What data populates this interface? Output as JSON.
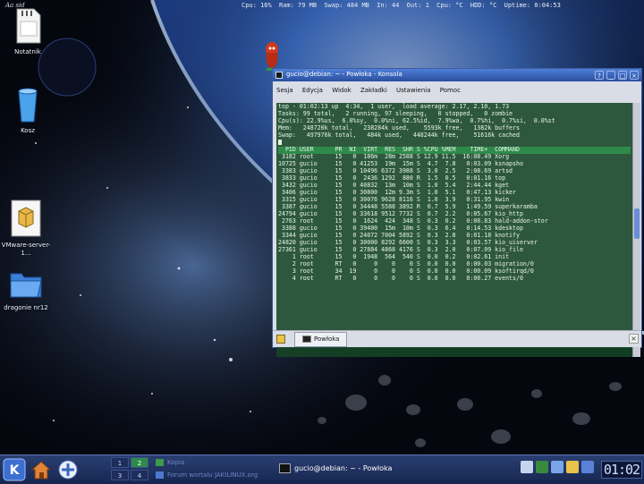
{
  "desktop": {
    "corner_text": "Aa sid",
    "icons": [
      {
        "label": "Notatnik"
      },
      {
        "label": "Kosz"
      },
      {
        "label": "VMware-server-1..."
      },
      {
        "label": "dragonie nr12"
      }
    ]
  },
  "system_monitor": {
    "items": [
      "Cpu: 16%",
      "Ram: 79 MB",
      "Swap: 484 MB",
      "In: 44",
      "Out: 1",
      "Cpu: °C",
      "HDD: °C",
      "Uptime: 0:04:53"
    ]
  },
  "konsole": {
    "title": "gucio@debian: ~ - Powłoka - Konsola",
    "menu": [
      "Sesja",
      "Edycja",
      "Widok",
      "Zakładki",
      "Ustawienia",
      "Pomoc"
    ],
    "tab_label": "Powłoka",
    "summary_lines": [
      "top - 01:02:13 up  4:34,  1 user,  load average: 2.17, 2.10, 1.73",
      "Tasks: 99 total,   2 running, 97 sleeping,   0 stopped,   0 zombie",
      "Cpu(s): 22.9%us,  6.0%sy,  0.0%ni, 62.5%id,  7.9%wa,  0.7%hi,  0.7%si,  0.0%st",
      "Mem:   248720k total,   238284k used,    5593k free,   1382k buffers",
      "Swap:   497976k total,   484k used,   448244k free,    51616k cached"
    ],
    "column_header": "  PID USER      PR  NI  VIRT  RES  SHR S %CPU %MEM    TIME+  COMMAND",
    "processes": [
      " 3182 root      15   0  186m  28m 2588 S 12.9 11.5  16:08.49 Xorg",
      "10725 gucio     15   0 41253  19m  15m S  4.7  7.8   0:03.09 ksnapsho",
      " 3383 gucio     15   0 10496 6372 3988 S  3.0  2.5   2:08.69 artsd",
      " 3833 gucio     15   0  2436 1292  880 R  1.5  0.5   0:01.16 top",
      " 3432 gucio     15   0 40832  13m  10m S  1.0  5.4   2:44.44 kget",
      " 3406 gucio     15   0 30800  12m 9.3m S  1.0  5.1   0:47.13 kicker",
      " 3315 gucio     15   0 30076 9628 8116 S  1.0  3.9   0:31.95 kwin",
      " 3387 gucio     15   0 34448 5588 3892 R  0.7  5.9   1:49.59 superkaramba",
      "24794 gucio     15   0 33618 9512 7732 S  0.7  2.2   0:05.67 kio_http",
      " 2763 root      15   0  1624  424  348 S  0.3  0.2   0:00.83 hald-addon-stor",
      " 3388 gucio     15   0 39400  15m  10m S  0.3  6.4   0:14.53 kdesktop",
      " 3344 gucio     15   0 24072 7004 5892 S  0.3  2.8   0:01.18 knotify",
      "24820 gucio     15   0 30000 8292 6600 S  0.3  3.3   0:03.57 kio_uiserver",
      "27361 gucio     15   0 27884 4868 4176 S  0.3  2.0   0:07.09 kio_file",
      "    1 root      15   0  1948  564  540 S  0.0  0.2   0:02.61 init",
      "    2 root      RT   0     0    0    0 S  0.0  0.0   0:00.03 migration/0",
      "    3 root      34  19     0    0    0 S  0.0  0.0   0:00.09 ksoftirqd/0",
      "    4 root      RT   0     0    0    0 S  0.0  0.0   0:00.27 events/0"
    ]
  },
  "taskbar": {
    "pager": [
      "1",
      "2",
      "3",
      "4"
    ],
    "task_list": [
      "Kopia",
      "Forum wortalu JAKILINUX.org"
    ],
    "active_task": "gucio@debian: ~ - Powłoka",
    "clock": "01:02"
  },
  "colors": {
    "terminal_bg": "#164626",
    "titlebar": "#3a66c0",
    "taskbar": "#1f3363",
    "accent": "#2f8a4a"
  }
}
